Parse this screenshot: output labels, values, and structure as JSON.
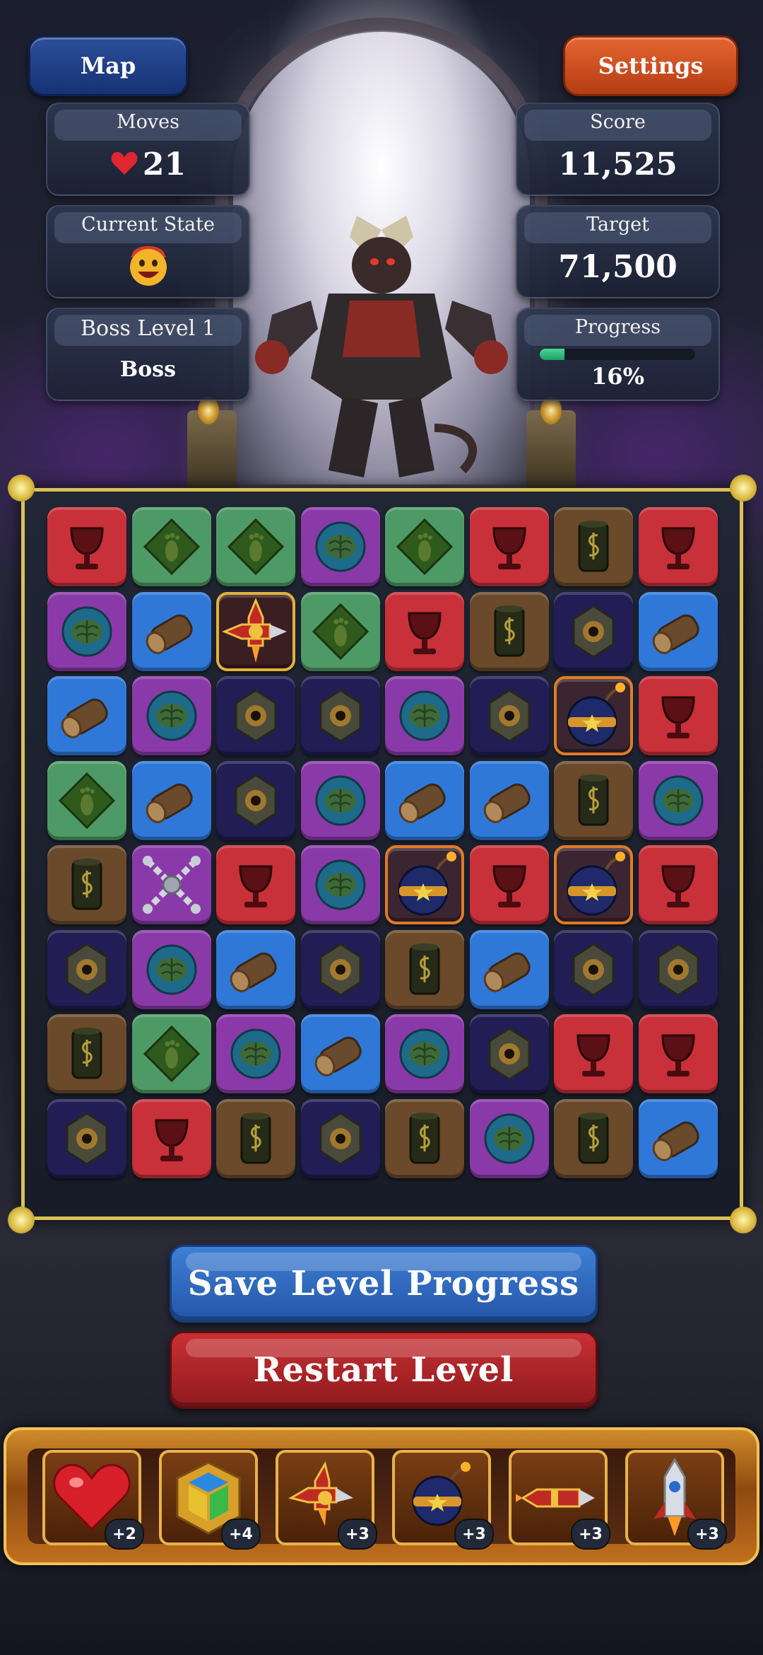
{
  "header": {
    "map_label": "Map",
    "settings_label": "Settings"
  },
  "stats": {
    "moves_label": "Moves",
    "moves_value": "21",
    "state_label": "Current State",
    "state_icon": "happy-face-icon",
    "level_label": "Boss Level 1",
    "level_type": "Boss",
    "score_label": "Score",
    "score_value": "11,525",
    "target_label": "Target",
    "target_value": "71,500",
    "progress_label": "Progress",
    "progress_value": 0.16,
    "progress_text": "16%"
  },
  "board": {
    "rows": 8,
    "cols": 8,
    "grid": [
      [
        "goblet",
        "footprint",
        "footprint",
        "brain",
        "footprint",
        "goblet",
        "barrel",
        "goblet"
      ],
      [
        "brain",
        "log",
        "rocket-cross",
        "footprint",
        "goblet",
        "barrel",
        "eye",
        "log"
      ],
      [
        "log",
        "brain",
        "eye",
        "eye",
        "brain",
        "eye",
        "bomb",
        "goblet"
      ],
      [
        "footprint",
        "log",
        "eye",
        "brain",
        "log",
        "log",
        "barrel",
        "brain"
      ],
      [
        "barrel",
        "chain-cross",
        "goblet",
        "brain",
        "bomb",
        "goblet",
        "bomb",
        "goblet"
      ],
      [
        "eye",
        "brain",
        "log",
        "eye",
        "barrel",
        "log",
        "eye",
        "eye"
      ],
      [
        "barrel",
        "footprint",
        "brain",
        "log",
        "brain",
        "eye",
        "goblet",
        "goblet"
      ],
      [
        "eye",
        "goblet",
        "barrel",
        "eye",
        "barrel",
        "brain",
        "barrel",
        "log"
      ]
    ]
  },
  "actions": {
    "save_label": "Save Level Progress",
    "restart_label": "Restart Level"
  },
  "boosters": [
    {
      "icon": "heart-icon",
      "count": "+2"
    },
    {
      "icon": "gem-cube-icon",
      "count": "+4"
    },
    {
      "icon": "rocket-cross-icon",
      "count": "+3"
    },
    {
      "icon": "bomb-icon",
      "count": "+3"
    },
    {
      "icon": "horizontal-rocket-icon",
      "count": "+3"
    },
    {
      "icon": "vertical-rocket-icon",
      "count": "+3"
    }
  ],
  "colors": {
    "goblet": "#c8303a",
    "footprint": "#4e9a66",
    "brain": "#8a3aa8",
    "barrel": "#6a4a2a",
    "log": "#2f78d8",
    "eye": "#221d55"
  }
}
